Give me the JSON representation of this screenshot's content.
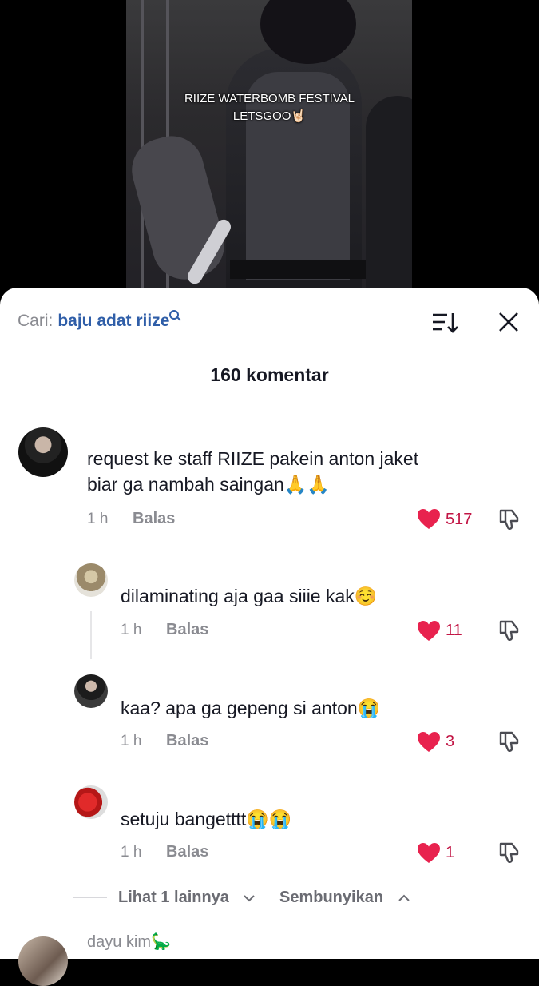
{
  "video": {
    "caption_line1": "RIIZE WATERBOMB FESTIVAL",
    "caption_line2": "LETSGOO🤘🏻"
  },
  "search": {
    "prefix": "Cari:",
    "term": "baju adat riize"
  },
  "comments_panel": {
    "title": "160 komentar"
  },
  "comments": [
    {
      "line1": "request ke staff RIIZE pakein anton jaket",
      "line2": "biar ga nambah saingan🙏🙏",
      "time": "1 h",
      "reply_label": "Balas",
      "likes": "517"
    }
  ],
  "replies": [
    {
      "text": "dilaminating aja gaa siiie kak☺️",
      "time": "1 h",
      "reply_label": "Balas",
      "likes": "11"
    },
    {
      "text": "kaa? apa ga gepeng si anton😭",
      "time": "1 h",
      "reply_label": "Balas",
      "likes": "3"
    },
    {
      "text": "setuju bangetttt😭😭",
      "time": "1 h",
      "reply_label": "Balas",
      "likes": "1"
    }
  ],
  "thread_controls": {
    "view_more": "Lihat 1 lainnya",
    "hide": "Sembunyikan"
  },
  "next_comment": {
    "username": "dayu kim🦕"
  },
  "colors": {
    "accent_link": "#2f5ea8",
    "like_red": "#e8224e",
    "muted_text": "#8a8b91",
    "primary_text": "#161823"
  }
}
